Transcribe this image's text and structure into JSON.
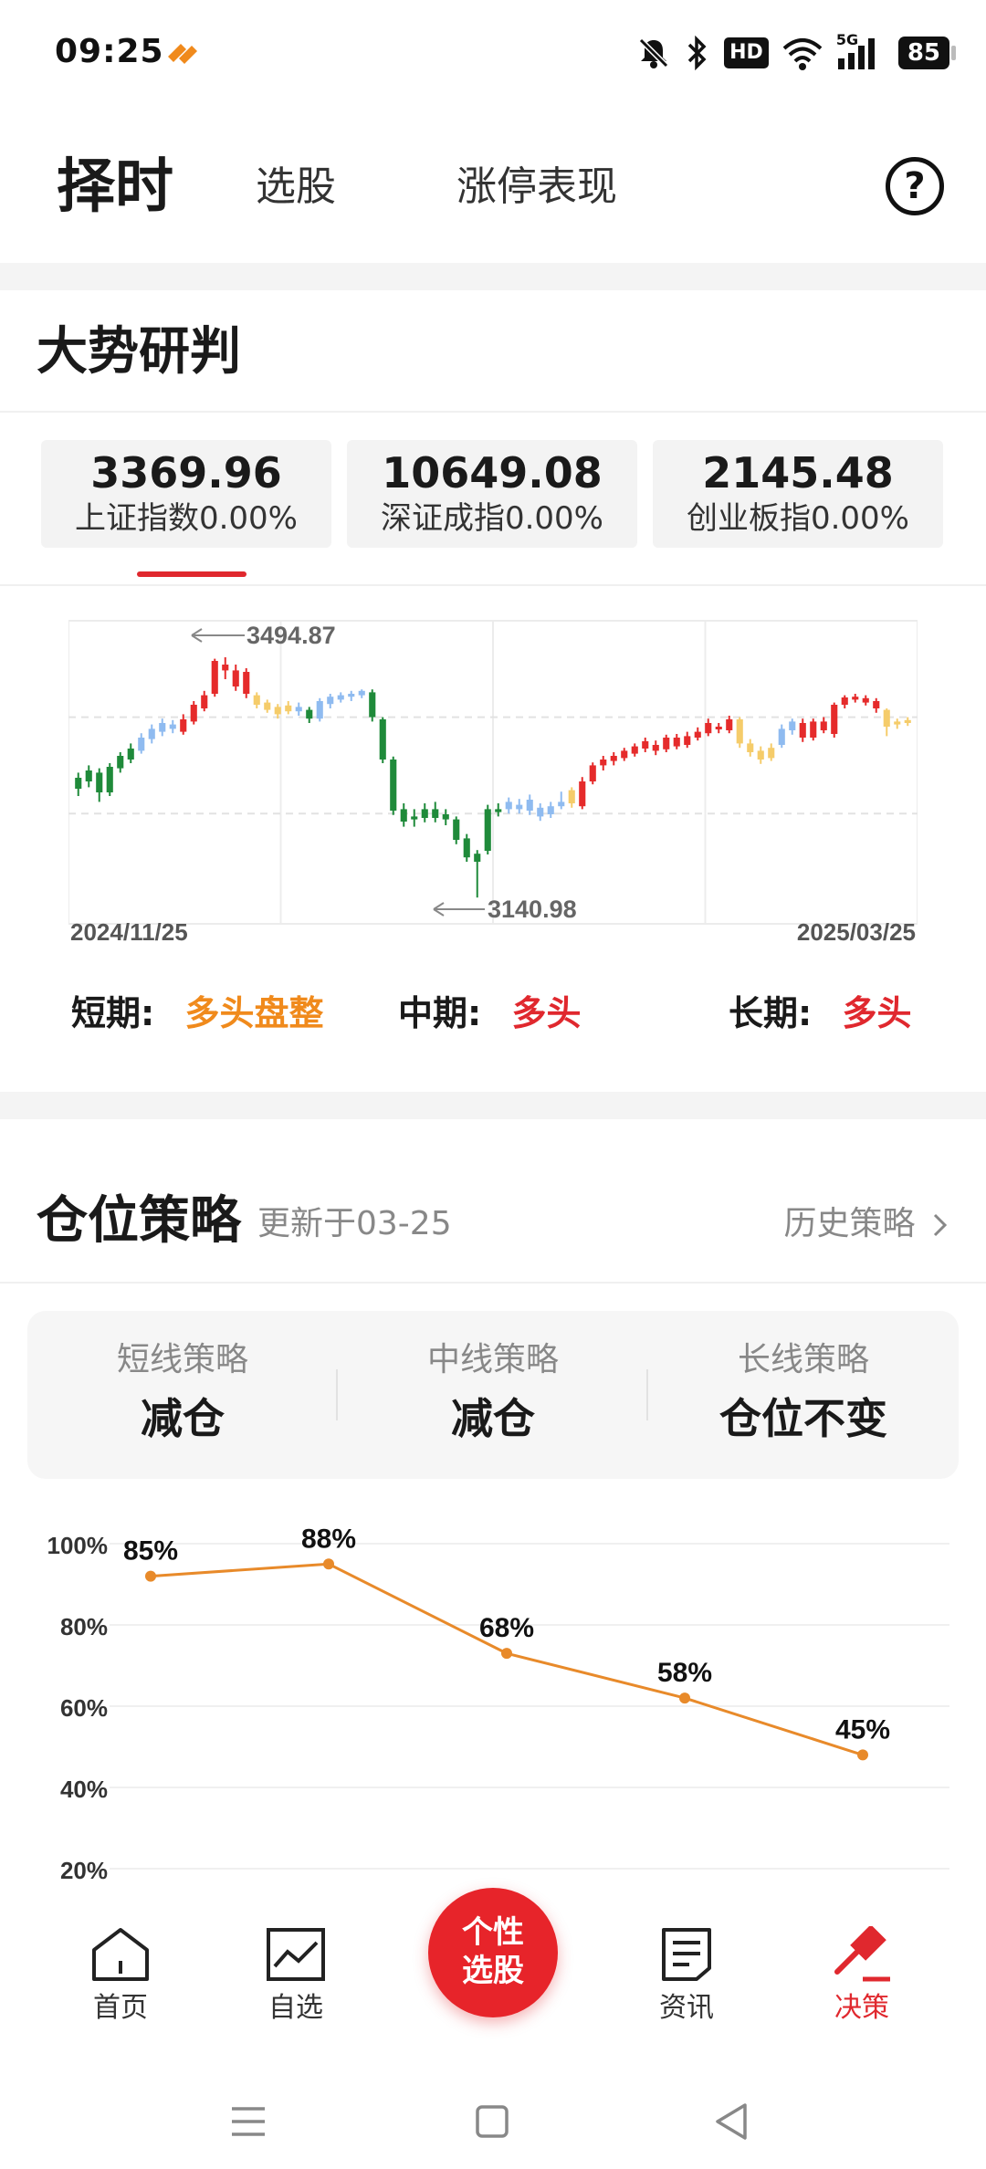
{
  "status_bar": {
    "time": "09:25",
    "network": "5G",
    "hd": "HD",
    "battery": "85"
  },
  "top_tabs": {
    "active": "择时",
    "tab2": "选股",
    "tab3": "涨停表现"
  },
  "help": "?",
  "trend_section": {
    "title": "大势研判",
    "indices": [
      {
        "value": "3369.96",
        "label": "上证指数0.00%"
      },
      {
        "value": "10649.08",
        "label": "深证成指0.00%"
      },
      {
        "value": "2145.48",
        "label": "创业板指0.00%"
      }
    ],
    "chart": {
      "high_label": "3494.87",
      "low_label": "3140.98",
      "start_date": "2024/11/25",
      "end_date": "2025/03/25"
    },
    "trends": [
      {
        "label": "短期:",
        "value": "多头盘整"
      },
      {
        "label": "中期:",
        "value": "多头"
      },
      {
        "label": "长期:",
        "value": "多头"
      }
    ]
  },
  "position_section": {
    "title": "仓位策略",
    "updated": "更新于03-25",
    "history_link": "历史策略",
    "strategies": [
      {
        "label": "短线策略",
        "value": "减仓"
      },
      {
        "label": "中线策略",
        "value": "减仓"
      },
      {
        "label": "长线策略",
        "value": "仓位不变"
      }
    ]
  },
  "bottom_nav": {
    "items": [
      {
        "label": "首页",
        "icon": "home-icon"
      },
      {
        "label": "自选",
        "icon": "chart-line-icon"
      },
      {
        "label": "资讯",
        "icon": "document-icon"
      },
      {
        "label": "决策",
        "icon": "gavel-icon"
      }
    ],
    "center_line1": "个性",
    "center_line2": "选股"
  },
  "colors": {
    "accent_red": "#e0282e",
    "orange": "#f08a1c",
    "candle_red": "#e52b2b",
    "candle_green": "#1f8a3a",
    "candle_blue": "#8fbbf0",
    "candle_yellow": "#f5cc6a"
  },
  "chart_data": [
    {
      "type": "candlestick",
      "title": "",
      "x_range": [
        "2024/11/25",
        "2025/03/25"
      ],
      "ylim": [
        3120,
        3520
      ],
      "annotations": [
        {
          "text": "3494.87",
          "type": "high"
        },
        {
          "text": "3140.98",
          "type": "low"
        }
      ],
      "series": [
        {
          "color_role": "green",
          "o": 3290,
          "c": 3305,
          "h": 3312,
          "l": 3280
        },
        {
          "color_role": "green",
          "o": 3300,
          "c": 3315,
          "h": 3322,
          "l": 3292
        },
        {
          "color_role": "green",
          "o": 3312,
          "c": 3285,
          "h": 3318,
          "l": 3272
        },
        {
          "color_role": "green",
          "o": 3285,
          "c": 3320,
          "h": 3325,
          "l": 3280
        },
        {
          "color_role": "green",
          "o": 3318,
          "c": 3335,
          "h": 3340,
          "l": 3312
        },
        {
          "color_role": "green",
          "o": 3330,
          "c": 3345,
          "h": 3352,
          "l": 3325
        },
        {
          "color_role": "blue",
          "o": 3342,
          "c": 3360,
          "h": 3366,
          "l": 3338
        },
        {
          "color_role": "blue",
          "o": 3358,
          "c": 3372,
          "h": 3378,
          "l": 3352
        },
        {
          "color_role": "blue",
          "o": 3368,
          "c": 3380,
          "h": 3386,
          "l": 3362
        },
        {
          "color_role": "blue",
          "o": 3378,
          "c": 3372,
          "h": 3384,
          "l": 3366
        },
        {
          "color_role": "red",
          "o": 3368,
          "c": 3385,
          "h": 3392,
          "l": 3364
        },
        {
          "color_role": "red",
          "o": 3382,
          "c": 3405,
          "h": 3410,
          "l": 3378
        },
        {
          "color_role": "red",
          "o": 3400,
          "c": 3418,
          "h": 3424,
          "l": 3396
        },
        {
          "color_role": "red",
          "o": 3420,
          "c": 3465,
          "h": 3468,
          "l": 3416
        },
        {
          "color_role": "red",
          "o": 3460,
          "c": 3452,
          "h": 3470,
          "l": 3440
        },
        {
          "color_role": "red",
          "o": 3430,
          "c": 3452,
          "h": 3460,
          "l": 3424
        },
        {
          "color_role": "red",
          "o": 3450,
          "c": 3420,
          "h": 3455,
          "l": 3414
        },
        {
          "color_role": "yellow",
          "o": 3418,
          "c": 3405,
          "h": 3422,
          "l": 3400
        },
        {
          "color_role": "yellow",
          "o": 3408,
          "c": 3398,
          "h": 3412,
          "l": 3394
        },
        {
          "color_role": "yellow",
          "o": 3402,
          "c": 3392,
          "h": 3406,
          "l": 3386
        },
        {
          "color_role": "yellow",
          "o": 3396,
          "c": 3404,
          "h": 3410,
          "l": 3392
        },
        {
          "color_role": "blue",
          "o": 3402,
          "c": 3396,
          "h": 3408,
          "l": 3390
        },
        {
          "color_role": "green",
          "o": 3398,
          "c": 3386,
          "h": 3402,
          "l": 3380
        },
        {
          "color_role": "blue",
          "o": 3386,
          "c": 3410,
          "h": 3414,
          "l": 3382
        },
        {
          "color_role": "blue",
          "o": 3406,
          "c": 3416,
          "h": 3420,
          "l": 3400
        },
        {
          "color_role": "blue",
          "o": 3412,
          "c": 3418,
          "h": 3422,
          "l": 3408
        },
        {
          "color_role": "blue",
          "o": 3416,
          "c": 3420,
          "h": 3424,
          "l": 3410
        },
        {
          "color_role": "blue",
          "o": 3418,
          "c": 3424,
          "h": 3426,
          "l": 3414
        },
        {
          "color_role": "green",
          "o": 3422,
          "c": 3388,
          "h": 3426,
          "l": 3382
        },
        {
          "color_role": "green",
          "o": 3385,
          "c": 3330,
          "h": 3388,
          "l": 3325
        },
        {
          "color_role": "green",
          "o": 3330,
          "c": 3260,
          "h": 3334,
          "l": 3254
        },
        {
          "color_role": "green",
          "o": 3262,
          "c": 3245,
          "h": 3270,
          "l": 3238
        },
        {
          "color_role": "green",
          "o": 3248,
          "c": 3252,
          "h": 3262,
          "l": 3238
        },
        {
          "color_role": "green",
          "o": 3250,
          "c": 3262,
          "h": 3270,
          "l": 3244
        },
        {
          "color_role": "green",
          "o": 3262,
          "c": 3250,
          "h": 3272,
          "l": 3244
        },
        {
          "color_role": "green",
          "o": 3255,
          "c": 3248,
          "h": 3262,
          "l": 3240
        },
        {
          "color_role": "green",
          "o": 3248,
          "c": 3220,
          "h": 3252,
          "l": 3214
        },
        {
          "color_role": "green",
          "o": 3222,
          "c": 3196,
          "h": 3228,
          "l": 3190
        },
        {
          "color_role": "green",
          "o": 3190,
          "c": 3201,
          "h": 3206,
          "l": 3141
        },
        {
          "color_role": "green",
          "o": 3205,
          "c": 3262,
          "h": 3268,
          "l": 3200
        },
        {
          "color_role": "green",
          "o": 3258,
          "c": 3262,
          "h": 3270,
          "l": 3252
        },
        {
          "color_role": "blue",
          "o": 3262,
          "c": 3272,
          "h": 3278,
          "l": 3256
        },
        {
          "color_role": "blue",
          "o": 3268,
          "c": 3262,
          "h": 3276,
          "l": 3256
        },
        {
          "color_role": "blue",
          "o": 3260,
          "c": 3275,
          "h": 3282,
          "l": 3254
        },
        {
          "color_role": "blue",
          "o": 3264,
          "c": 3252,
          "h": 3270,
          "l": 3246
        },
        {
          "color_role": "blue",
          "o": 3255,
          "c": 3266,
          "h": 3272,
          "l": 3250
        },
        {
          "color_role": "blue",
          "o": 3266,
          "c": 3272,
          "h": 3286,
          "l": 3262
        },
        {
          "color_role": "yellow",
          "o": 3270,
          "c": 3288,
          "h": 3292,
          "l": 3264
        },
        {
          "color_role": "red",
          "o": 3266,
          "c": 3300,
          "h": 3306,
          "l": 3262
        },
        {
          "color_role": "red",
          "o": 3300,
          "c": 3322,
          "h": 3326,
          "l": 3296
        },
        {
          "color_role": "red",
          "o": 3322,
          "c": 3330,
          "h": 3335,
          "l": 3315
        },
        {
          "color_role": "red",
          "o": 3328,
          "c": 3335,
          "h": 3340,
          "l": 3322
        },
        {
          "color_role": "red",
          "o": 3332,
          "c": 3342,
          "h": 3346,
          "l": 3328
        },
        {
          "color_role": "red",
          "o": 3338,
          "c": 3348,
          "h": 3352,
          "l": 3334
        },
        {
          "color_role": "red",
          "o": 3345,
          "c": 3355,
          "h": 3360,
          "l": 3340
        },
        {
          "color_role": "red",
          "o": 3350,
          "c": 3342,
          "h": 3356,
          "l": 3336
        },
        {
          "color_role": "red",
          "o": 3344,
          "c": 3360,
          "h": 3364,
          "l": 3340
        },
        {
          "color_role": "red",
          "o": 3360,
          "c": 3348,
          "h": 3365,
          "l": 3344
        },
        {
          "color_role": "red",
          "o": 3350,
          "c": 3362,
          "h": 3368,
          "l": 3346
        },
        {
          "color_role": "red",
          "o": 3360,
          "c": 3368,
          "h": 3374,
          "l": 3356
        },
        {
          "color_role": "red",
          "o": 3366,
          "c": 3380,
          "h": 3386,
          "l": 3362
        },
        {
          "color_role": "red",
          "o": 3375,
          "c": 3372,
          "h": 3380,
          "l": 3366
        },
        {
          "color_role": "red",
          "o": 3370,
          "c": 3385,
          "h": 3390,
          "l": 3366
        },
        {
          "color_role": "yellow",
          "o": 3385,
          "c": 3352,
          "h": 3388,
          "l": 3346
        },
        {
          "color_role": "yellow",
          "o": 3352,
          "c": 3340,
          "h": 3358,
          "l": 3334
        },
        {
          "color_role": "yellow",
          "o": 3342,
          "c": 3330,
          "h": 3348,
          "l": 3324
        },
        {
          "color_role": "yellow",
          "o": 3332,
          "c": 3346,
          "h": 3352,
          "l": 3328
        },
        {
          "color_role": "blue",
          "o": 3350,
          "c": 3372,
          "h": 3378,
          "l": 3346
        },
        {
          "color_role": "blue",
          "o": 3370,
          "c": 3382,
          "h": 3386,
          "l": 3364
        },
        {
          "color_role": "red",
          "o": 3380,
          "c": 3360,
          "h": 3386,
          "l": 3354
        },
        {
          "color_role": "red",
          "o": 3360,
          "c": 3382,
          "h": 3386,
          "l": 3356
        },
        {
          "color_role": "red",
          "o": 3382,
          "c": 3370,
          "h": 3388,
          "l": 3366
        },
        {
          "color_role": "red",
          "o": 3365,
          "c": 3405,
          "h": 3408,
          "l": 3360
        },
        {
          "color_role": "red",
          "o": 3405,
          "c": 3415,
          "h": 3418,
          "l": 3400
        },
        {
          "color_role": "red",
          "o": 3412,
          "c": 3416,
          "h": 3420,
          "l": 3408
        },
        {
          "color_role": "red",
          "o": 3414,
          "c": 3408,
          "h": 3418,
          "l": 3404
        },
        {
          "color_role": "red",
          "o": 3410,
          "c": 3400,
          "h": 3414,
          "l": 3394
        },
        {
          "color_role": "yellow",
          "o": 3398,
          "c": 3375,
          "h": 3400,
          "l": 3362
        },
        {
          "color_role": "yellow",
          "o": 3378,
          "c": 3382,
          "h": 3386,
          "l": 3372
        },
        {
          "color_role": "yellow",
          "o": 3380,
          "c": 3384,
          "h": 3388,
          "l": 3376
        }
      ]
    },
    {
      "type": "line",
      "title": "",
      "ylabel": "",
      "yticks": [
        "100%",
        "80%",
        "60%",
        "40%",
        "20%"
      ],
      "ylim": [
        0,
        100
      ],
      "series": [
        {
          "values": [
            85,
            88,
            68,
            58,
            45
          ],
          "labels": [
            "85%",
            "88%",
            "68%",
            "58%",
            "45%"
          ]
        }
      ],
      "plot_values": [
        92,
        95,
        73,
        62,
        48
      ],
      "color": "#e88a2a"
    }
  ]
}
